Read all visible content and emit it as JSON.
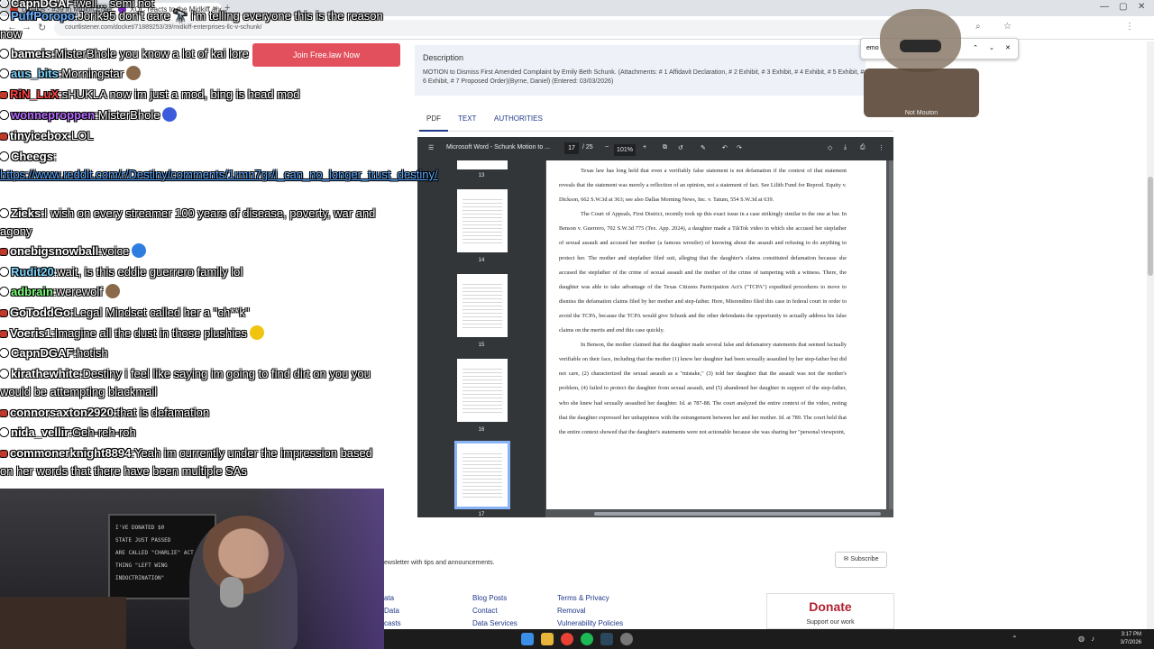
{
  "browser": {
    "tabs": [
      {
        "label": "Dinakis - #39 in Midkiff Enterpri",
        "favicon_color": "#c0392b"
      },
      {
        "label": "XQC reacts to the Midkiff and Li",
        "favicon_color": "#7b2cbf"
      }
    ],
    "url": "courtlistener.com/docket/71889253/39/midkiff-enterprises-llc-v-schunk/"
  },
  "page": {
    "join_button": "Join Free.law Now",
    "description_title": "Description",
    "description_text": "MOTION to Dismiss First Amended Complaint by Emily Beth Schunk. (Attachments: # 1 Affidavit Declaration, # 2 Exhibit, # 3 Exhibit, # 4 Exhibit, # 5 Exhibit, # 6 Exhibit, # 7 Proposed Order)(Byrne, Daniel) (Entered: 03/03/2026)",
    "tabs": [
      "PDF",
      "TEXT",
      "AUTHORITIES"
    ],
    "active_tab": "PDF"
  },
  "pdf": {
    "filename": "Microsoft Word - Schunk Motion to ...",
    "current_page": "17",
    "total_pages": "/ 25",
    "zoom": "101%",
    "thumbnails": [
      {
        "num": "13"
      },
      {
        "num": "14"
      },
      {
        "num": "15"
      },
      {
        "num": "16"
      },
      {
        "num": "17"
      }
    ],
    "paragraphs": [
      "Texas law has long held that even a verifiably false statement is not defamation if the context of that statement reveals that the statement was merely a reflection of an opinion, not a statement of fact. See Lilith Fund for Reprod. Equity v. Dickson, 662 S.W.3d at 363; see also Dallas Morning News, Inc. v. Tatum, 554 S.W.3d at 639.",
      "The Court of Appeals, First District, recently took up this exact issue in a case strikingly similar to the one at bar. In Benson v. Guerrero, 702 S.W.3d 775 (Tex. App. 2024), a daughter made a TikTok video in which she accused her stepfather of sexual assault and accused her mother (a famous wrestler) of knowing about the assault and refusing to do anything to protect her. The mother and stepfather filed suit, alleging that the daughter's claims constituted defamation because she accused the stepfather of the crime of sexual assault and the mother of the crime of tampering with a witness. There, the daughter was able to take advantage of the Texas Citizens Participation Act's (\"TCPA\") expedited procedures to move to dismiss the defamation claims filed by her mother and step-father. Here, Misrendino filed this case in federal court in order to avoid the TCPA, because the TCPA would give Schunk and the other defendants the opportunity to actually address his false claims on the merits and end this case quickly.",
      "In Benson, the mother claimed that the daughter made several false and defamatory statements that seemed factually verifiable on their face, including that the mother (1) knew her daughter had been sexually assaulted by her step-father but did not care, (2) characterized the sexual assault as a \"mistake,\" (3) told her daughter that the assault was not the mother's problem, (4) failed to protect the daughter from sexual assault, and (5) abandoned her daughter in support of the step-father, who she knew had sexually assaulted her daughter. Id. at 787-88. The court analyzed the entire context of the video, noting that the daughter expressed her unhappiness with the estrangement between her and her mother. Id. at 789. The court held that the entire context showed that the daughter's statements were not actionable because she was sharing her \"personal viewpoint,"
    ]
  },
  "footer": {
    "newsletter_text": "ewsletter with tips and announcements.",
    "subscribe_label": "Subscribe",
    "col1": [
      "ata",
      "Data",
      "casts"
    ],
    "col2": [
      "Blog Posts",
      "Contact",
      "Data Services"
    ],
    "col3": [
      "Terms & Privacy",
      "Removal",
      "Vulnerability Policies"
    ],
    "donate_title": "Donate",
    "donate_sub": "Support our work"
  },
  "taskbar": {
    "time": "3:17 PM",
    "date": "3/7/2026"
  },
  "chat": [
    {
      "user": "CapnDGAF",
      "msg": "well... semi not",
      "dot": "outline",
      "ucolor": "#ffffff"
    },
    {
      "user": "PuffPoropo",
      "msg": "Jorik95 don't care 🔭 i'm telling everyone this is the reason now",
      "dot": "outline",
      "ucolor": "#6ab0ff"
    },
    {
      "user": "bameis",
      "msg": "MisterBhole you know a lot of kai lore",
      "dot": "outline",
      "ucolor": "#ffffff"
    },
    {
      "user": "aus_bits",
      "msg": "Morningstar",
      "dot": "outline",
      "ucolor": "#7fd6ff",
      "emote": "#8a6a4a"
    },
    {
      "user": "RiN_LuX",
      "msg": "sHUKLA now im just a mod, bing is head mod",
      "dot": "red",
      "ucolor": "#ff4040"
    },
    {
      "user": "wonneproppen",
      "msg": "MisterBhole",
      "dot": "outline",
      "ucolor": "#b56bff",
      "emote": "#3b5bdb"
    },
    {
      "user": "tinyicebox",
      "msg": "LOL",
      "dot": "red",
      "ucolor": "#ffffff"
    },
    {
      "user": "Cheegs",
      "msg": "",
      "dot": "outline",
      "ucolor": "#ffffff"
    },
    {
      "user": "",
      "msg": "https://www.reddit.com/r/Destiny/comments/1rmn7gr/i_can_no_longer_trust_destiny/",
      "dot": "none",
      "ucolor": "#ffffff",
      "link": true
    },
    {
      "user": "Zieks",
      "msg": "I wish on every streamer 100 years of disease, poverty, war and agony",
      "dot": "outline",
      "ucolor": "#ffffff"
    },
    {
      "user": "onebigsnowball",
      "msg": "voice",
      "dot": "red",
      "ucolor": "#ffffff",
      "emote": "#2f7de1"
    },
    {
      "user": "Rudit20",
      "msg": "wait, is this eddie guerrero family lol",
      "dot": "outline",
      "ucolor": "#7fd6ff"
    },
    {
      "user": "adbrain",
      "msg": "werewolf",
      "dot": "outline",
      "ucolor": "#7fff7f",
      "emote": "#8a6a4a"
    },
    {
      "user": "GoToddGo",
      "msg": "Legal Mindset called her a \"ch**k\"",
      "dot": "red",
      "ucolor": "#ffffff"
    },
    {
      "user": "Voeris1",
      "msg": "Imagine all the dust in those plushies",
      "dot": "red",
      "ucolor": "#ffffff",
      "emote": "#f1c40f"
    },
    {
      "user": "CapnDGAF",
      "msg": "hotish",
      "dot": "outline",
      "ucolor": "#ffffff"
    },
    {
      "user": "kirathewhite",
      "msg": "Destiny i feel like saying im going to find dirt on you you would be attempting blackmail",
      "dot": "outline",
      "ucolor": "#ffffff"
    },
    {
      "user": "connorsaxton2920",
      "msg": "that is defamation",
      "dot": "red",
      "ucolor": "#ffffff"
    },
    {
      "user": "nida_vellir",
      "msg": "Geh-reh-roh",
      "dot": "outline",
      "ucolor": "#ffffff"
    },
    {
      "user": "commonerknight8894",
      "msg": "Yeah im currently under the impression based on her words that there have been multiple SAs",
      "dot": "red",
      "ucolor": "#ffffff"
    }
  ],
  "webcam": {
    "board_lines": [
      "I'VE DONATED $0",
      "STATE JUST PASSED",
      "ARE CALLED \"CHARLIE\" ACT",
      "THING \"LEFT WING",
      "INDOCTRINATION\""
    ]
  },
  "avatar": {
    "plate": "Not Mouton"
  }
}
